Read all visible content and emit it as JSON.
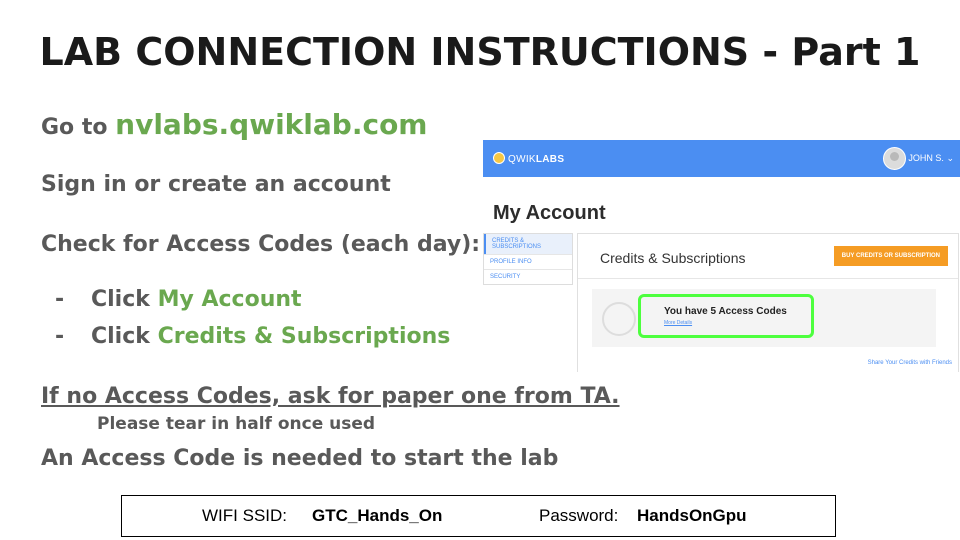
{
  "title": "LAB CONNECTION INSTRUCTIONS - Part 1",
  "step1": {
    "prefix": "Go to",
    "url": "nvlabs.qwiklab.com"
  },
  "step2": "Sign in or create an account",
  "step3": "Check for Access Codes (each day):",
  "bullets": [
    {
      "dash": "-",
      "prefix": "Click",
      "target": "My Account"
    },
    {
      "dash": "-",
      "prefix": "Click",
      "target": "Credits & Subscriptions"
    }
  ],
  "note": "If no Access Codes, ask for paper one from TA.",
  "subnote": "Please tear in half once used",
  "needed": "An Access Code is needed to start the lab",
  "wifi": {
    "ssid_label": "WIFI SSID:",
    "ssid": "GTC_Hands_On",
    "password_label": "Password:",
    "password": "HandsOnGpu"
  },
  "screenshot": {
    "brand_pre": "QWIK",
    "brand_bold": "LABS",
    "user": "JOHN S.",
    "user_caret": "⌄",
    "page_title": "My Account",
    "sidebar": [
      "CREDITS & SUBSCRIPTIONS",
      "PROFILE INFO",
      "SECURITY"
    ],
    "panel_title": "Credits & Subscriptions",
    "buy_button": "BUY CREDITS OR SUBSCRIPTION",
    "codes_text": "You have 5 Access Codes",
    "more_details": "More Details",
    "share_link": "Share Your Credits with Friends",
    "colors": {
      "header": "#4b8ef2",
      "buy": "#f59c24",
      "highlight": "#4dff3e"
    }
  },
  "colors": {
    "accent_green": "#6aa84f",
    "text_gray": "#595959",
    "title": "#1a1a1a"
  }
}
